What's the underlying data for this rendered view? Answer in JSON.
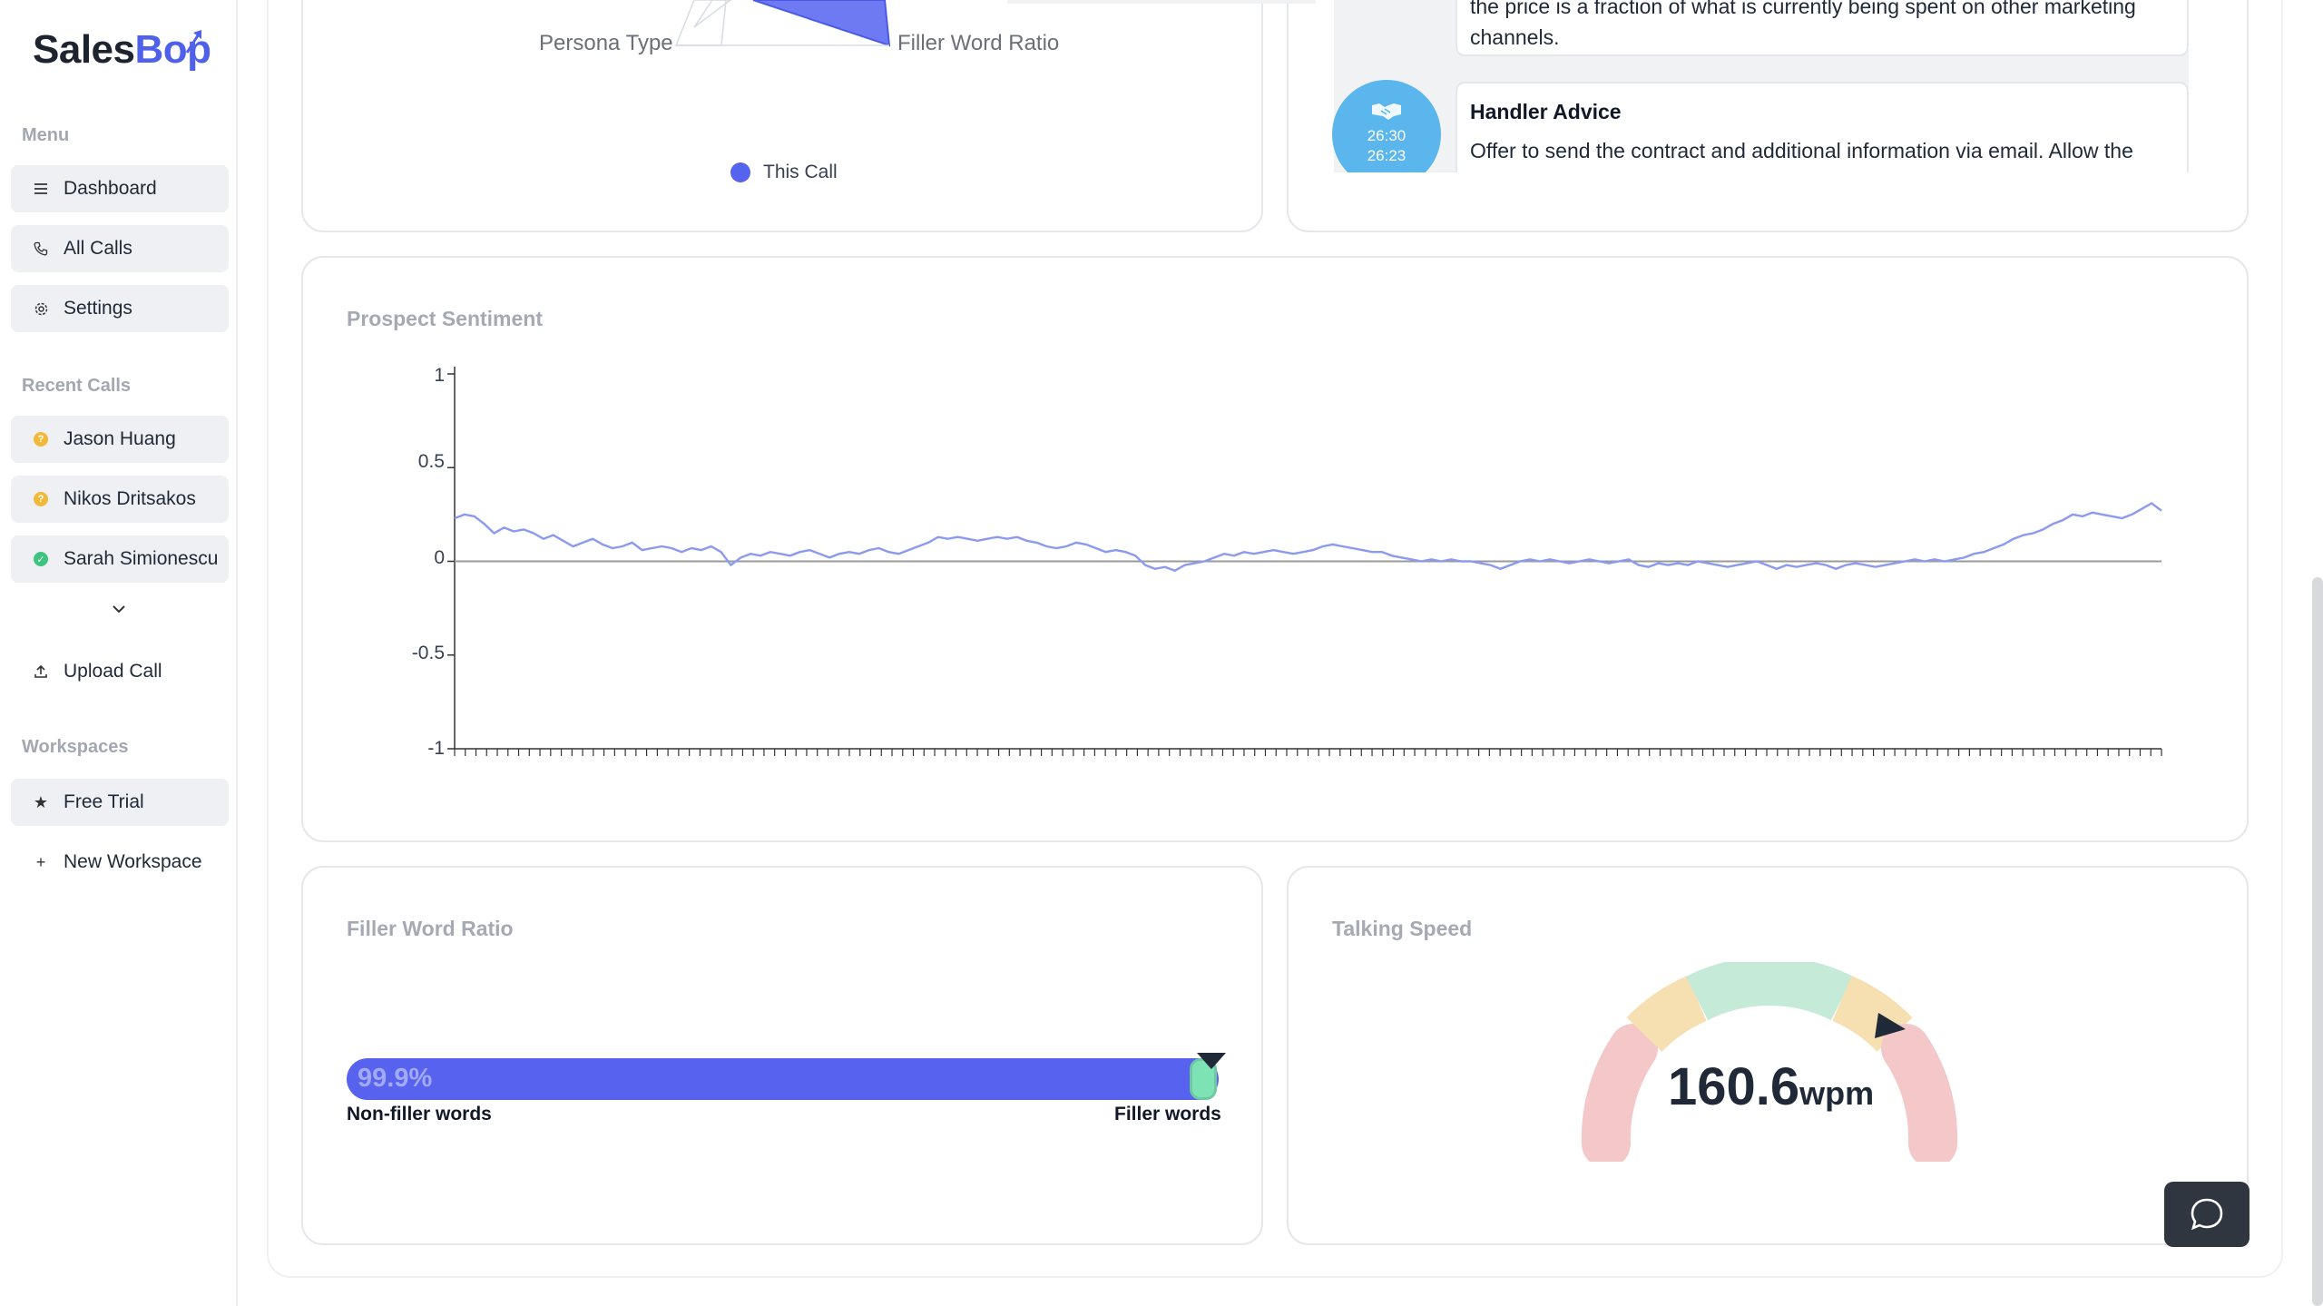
{
  "brand": {
    "name_part1": "Sales",
    "name_part2": "Bop",
    "accent": "#4f61e8"
  },
  "sidebar": {
    "menu_title": "Menu",
    "menu_items": [
      {
        "label": "Dashboard",
        "icon": "menu-lines-icon"
      },
      {
        "label": "All Calls",
        "icon": "phone-icon"
      },
      {
        "label": "Settings",
        "icon": "gear-icon"
      }
    ],
    "recent_title": "Recent Calls",
    "recent_calls": [
      {
        "label": "Jason Huang",
        "status": "pending",
        "color": "#f2b83a"
      },
      {
        "label": "Nikos Dritsakos",
        "status": "pending",
        "color": "#f2b83a"
      },
      {
        "label": "Sarah Simionescu",
        "status": "complete",
        "color": "#3dc47e"
      }
    ],
    "upload_label": "Upload Call",
    "workspaces_title": "Workspaces",
    "workspaces": [
      {
        "label": "Free Trial",
        "icon": "star-icon"
      },
      {
        "label": "New Workspace",
        "icon": "plus-icon"
      }
    ]
  },
  "persona_card": {
    "axis_left": "Persona Type",
    "axis_right": "Filler Word Ratio",
    "legend": "This Call",
    "legend_color": "#5563ef"
  },
  "advice_card": {
    "prev_text_line1": "the price is a fraction of what is currently being spent on other marketing",
    "prev_text_line2": "channels.",
    "handler_title": "Handler Advice",
    "handler_text": "Offer to send the contract and additional information via email. Allow the",
    "time_start": "26:30",
    "time_end": "26:23"
  },
  "sentiment_card": {
    "title": "Prospect Sentiment"
  },
  "chart_data": {
    "type": "line",
    "title": "Prospect Sentiment",
    "ylim": [
      -1,
      1
    ],
    "yticks": [
      "1",
      "0.5",
      "0",
      "-0.5",
      "-1"
    ],
    "color": "#8b9af0",
    "series": [
      {
        "values": [
          0.23,
          0.25,
          0.24,
          0.2,
          0.15,
          0.18,
          0.16,
          0.17,
          0.15,
          0.12,
          0.14,
          0.11,
          0.08,
          0.1,
          0.12,
          0.09,
          0.07,
          0.08,
          0.1,
          0.06,
          0.07,
          0.08,
          0.07,
          0.05,
          0.07,
          0.06,
          0.08,
          0.05,
          -0.02,
          0.02,
          0.04,
          0.03,
          0.05,
          0.04,
          0.03,
          0.05,
          0.06,
          0.04,
          0.02,
          0.04,
          0.05,
          0.04,
          0.06,
          0.07,
          0.05,
          0.04,
          0.06,
          0.08,
          0.1,
          0.13,
          0.12,
          0.13,
          0.12,
          0.11,
          0.12,
          0.13,
          0.12,
          0.13,
          0.11,
          0.1,
          0.08,
          0.07,
          0.08,
          0.1,
          0.09,
          0.07,
          0.05,
          0.06,
          0.05,
          0.03,
          -0.02,
          -0.04,
          -0.03,
          -0.05,
          -0.02,
          -0.01,
          0.0,
          0.02,
          0.04,
          0.03,
          0.05,
          0.04,
          0.05,
          0.06,
          0.05,
          0.04,
          0.05,
          0.06,
          0.08,
          0.09,
          0.08,
          0.07,
          0.06,
          0.05,
          0.05,
          0.03,
          0.02,
          0.01,
          0.0,
          0.01,
          0.0,
          0.01,
          0.0,
          0.0,
          -0.01,
          -0.02,
          -0.04,
          -0.02,
          0.0,
          0.01,
          0.0,
          0.01,
          0.0,
          -0.01,
          0.0,
          0.01,
          0.0,
          -0.01,
          0.0,
          0.01,
          -0.02,
          -0.03,
          -0.01,
          -0.02,
          -0.01,
          -0.02,
          0.0,
          -0.01,
          -0.02,
          -0.03,
          -0.02,
          -0.01,
          0.0,
          -0.02,
          -0.04,
          -0.02,
          -0.03,
          -0.02,
          -0.01,
          -0.02,
          -0.04,
          -0.02,
          -0.01,
          -0.02,
          -0.03,
          -0.02,
          -0.01,
          0.0,
          0.01,
          0.0,
          0.01,
          0.0,
          0.01,
          0.02,
          0.04,
          0.05,
          0.07,
          0.09,
          0.12,
          0.14,
          0.15,
          0.17,
          0.2,
          0.22,
          0.25,
          0.24,
          0.26,
          0.25,
          0.24,
          0.23,
          0.25,
          0.28,
          0.31,
          0.27
        ]
      }
    ]
  },
  "filler_card": {
    "title": "Filler Word Ratio",
    "percent_label": "99.9%",
    "ratio": 0.999,
    "left_label": "Non-filler words",
    "right_label": "Filler words"
  },
  "speed_card": {
    "title": "Talking Speed",
    "value": "160.6",
    "unit": "wpm",
    "zones": [
      "#f4c7c8",
      "#f6dfb0",
      "#c6ead8",
      "#f6dfb0",
      "#f4c7c8"
    ]
  }
}
